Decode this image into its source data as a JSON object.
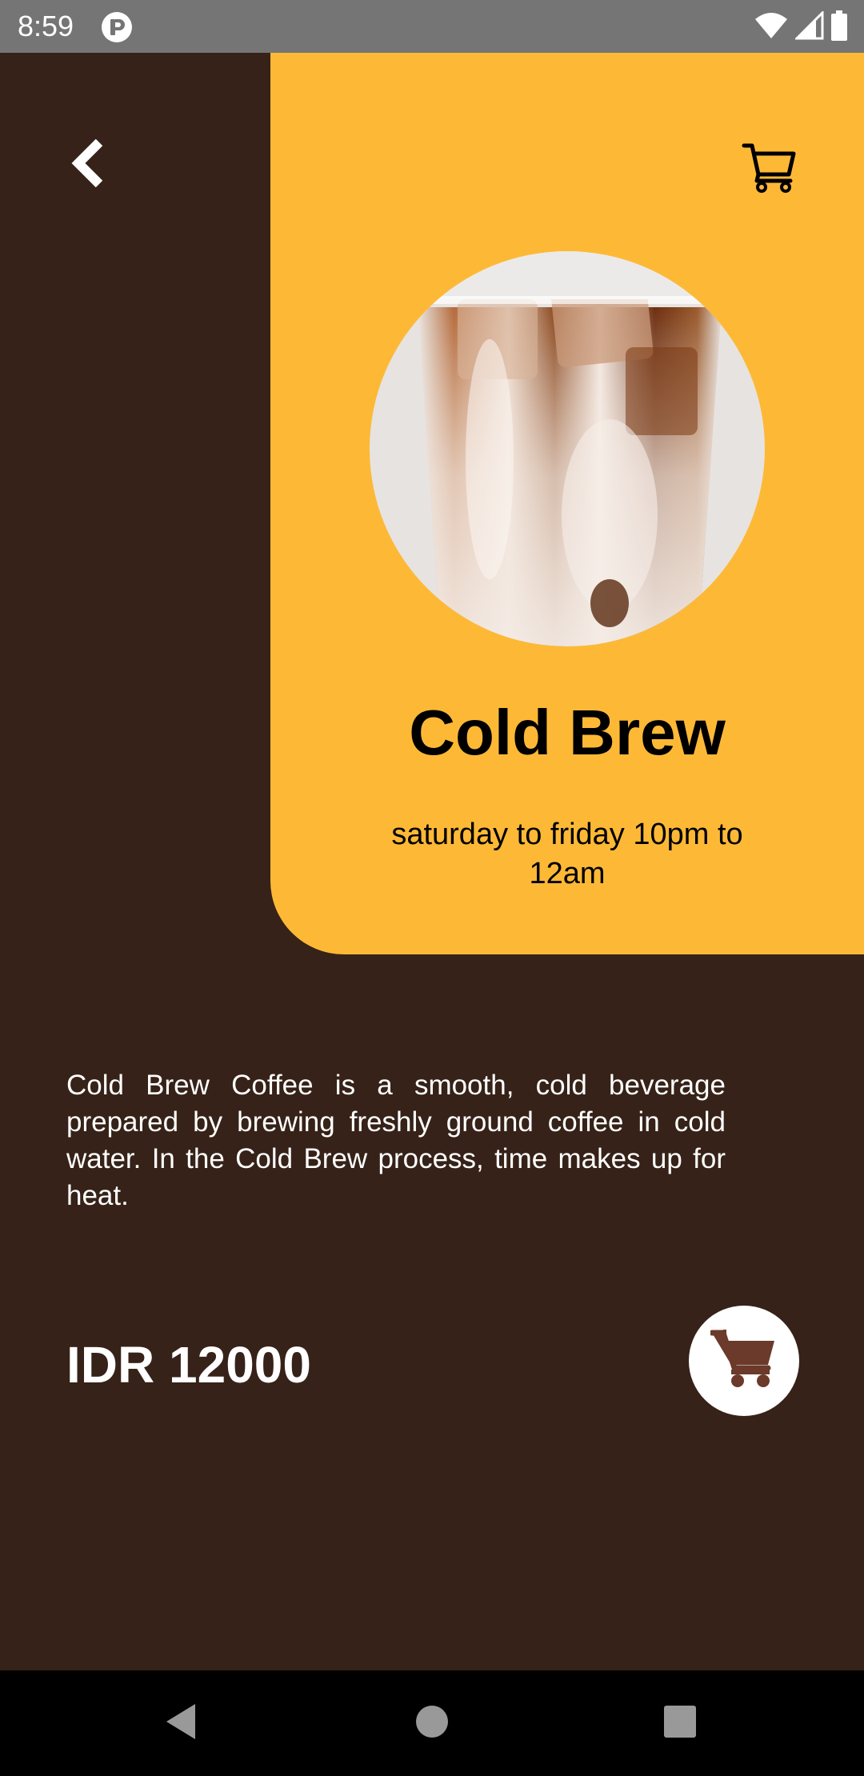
{
  "status_bar": {
    "time": "8:59",
    "icons": [
      "app-notification-icon",
      "wifi-icon",
      "signal-icon",
      "battery-icon"
    ]
  },
  "header": {
    "back_icon": "chevron-left-icon",
    "cart_icon": "cart-outline-icon"
  },
  "product": {
    "name": "Cold Brew",
    "hours": "saturday to friday 10pm to 12am",
    "description": "Cold Brew Coffee is a smooth, cold beverage prepared by brewing freshly ground coffee in cold water. In the Cold Brew process, time makes up for heat.",
    "price": "IDR 12000",
    "image": "iced-coffee-glass-photo"
  },
  "actions": {
    "add_to_cart_icon": "cart-filled-icon"
  },
  "navigation": {
    "buttons": [
      "back-triangle-icon",
      "home-circle-icon",
      "recents-square-icon"
    ]
  },
  "colors": {
    "background": "#362218",
    "accent": "#FDB936",
    "text_on_accent": "#000000",
    "text_on_background": "#FFFFFF",
    "cart_icon_brown": "#6B3A2A",
    "status_bar": "#757575",
    "nav_bar": "#000000"
  }
}
